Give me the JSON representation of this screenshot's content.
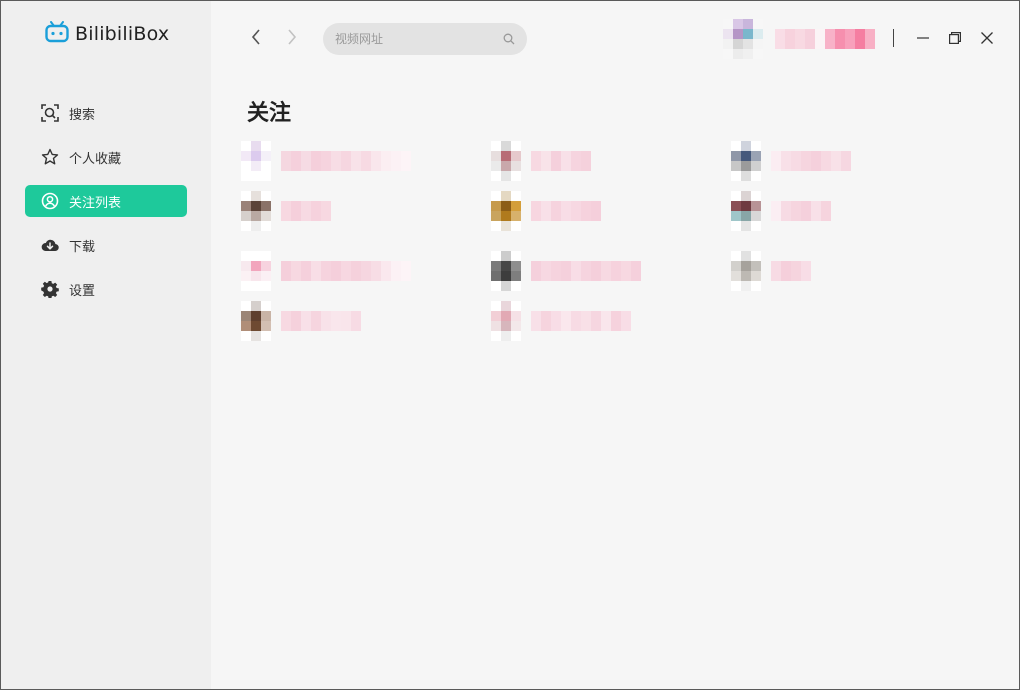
{
  "app": {
    "title": "BilibiliBox"
  },
  "colors": {
    "accent": "#1ec99b",
    "logo": "#1a9fd9"
  },
  "sidebar": {
    "items": [
      {
        "label": "搜索",
        "icon": "search-icon",
        "active": false
      },
      {
        "label": "个人收藏",
        "icon": "star-icon",
        "active": false
      },
      {
        "label": "关注列表",
        "icon": "user-circle-icon",
        "active": true
      },
      {
        "label": "下载",
        "icon": "cloud-download-icon",
        "active": false
      },
      {
        "label": "设置",
        "icon": "gear-icon",
        "active": false
      }
    ]
  },
  "topbar": {
    "back_icon": "chevron-left-icon",
    "forward_icon": "chevron-right-icon",
    "search": {
      "placeholder": "视频网址",
      "value": "",
      "icon": "search-icon"
    },
    "window_controls": [
      "minimize-icon",
      "restore-icon",
      "close-icon"
    ]
  },
  "main": {
    "title": "关注"
  },
  "follows": [
    {
      "avatar": [
        "#fff",
        "#e8dcef",
        "#fff",
        "#f2e9f6",
        "#dccbee",
        "#f4f0f8",
        "#fff",
        "#f3ecf6",
        "#fff",
        "#fff",
        "#fff",
        "#fff"
      ],
      "name": [
        "#f5d7e0",
        "#f5d0dc",
        "#f6dbe4",
        "#f5cfdb",
        "#f6d3de",
        "#f7dde5",
        "#f6d6e0",
        "#f8e2e9",
        "#f7dae3",
        "#f9e6ec",
        "#fbeef2",
        "#fcf1f5",
        "#fdf4f7"
      ]
    },
    {
      "avatar": [
        "#fff",
        "#d9d9d9",
        "#fff",
        "#e7dede",
        "#b86d76",
        "#e6c9cc",
        "#eaeaea",
        "#c9a8ab",
        "#e8e0e0",
        "#fff",
        "#e5e5e5",
        "#fff"
      ],
      "name": [
        "#f7d9e2",
        "#f8e3e9",
        "#f5d0dc",
        "#f8e0e8",
        "#f6d4df",
        "#f5d1dc"
      ]
    },
    {
      "avatar": [
        "#fff",
        "#cfd3dd",
        "#fff",
        "#8f97a8",
        "#46597c",
        "#9aa3b4",
        "#c7c7c7",
        "#9b9b9b",
        "#d0d0d0",
        "#fff",
        "#dedede",
        "#fff"
      ],
      "name": [
        "#fbedf2",
        "#f8e0e8",
        "#f7dbe4",
        "#f6d5df",
        "#f5d0dc",
        "#f7d9e2",
        "#f8e1e8",
        "#f6d7e1"
      ]
    },
    {
      "avatar": [
        "#fff",
        "#e6e0dc",
        "#fff",
        "#9a8278",
        "#5b4338",
        "#8a7268",
        "#d6d0cc",
        "#b9a9a2",
        "#e2dcd8",
        "#fff",
        "#eeeeee",
        "#fff"
      ],
      "name": [
        "#f7d8e1",
        "#f5cfdb",
        "#f7dae3",
        "#f6d2dd",
        "#f7d8e1"
      ]
    },
    {
      "avatar": [
        "#fff",
        "#e4d8c2",
        "#fff",
        "#c69a4b",
        "#8c5d17",
        "#d49e3a",
        "#c9a45e",
        "#b07a1d",
        "#d7b16c",
        "#fff",
        "#e9e3d9",
        "#fff"
      ],
      "name": [
        "#f7d6e0",
        "#f8e0e8",
        "#f6d3de",
        "#f8dde6",
        "#f7d8e2",
        "#f6d2dd",
        "#f5cfdb"
      ]
    },
    {
      "avatar": [
        "#fff",
        "#dbd3d3",
        "#fff",
        "#8a4f55",
        "#6f3a40",
        "#b89396",
        "#9fc6c9",
        "#88a6a7",
        "#d8d8d8",
        "#fff",
        "#e4e4e4",
        "#fff"
      ],
      "name": [
        "#fbeef3",
        "#f7dbe4",
        "#f6d5df",
        "#f5d0dc",
        "#f8e0e8",
        "#f6d4de"
      ]
    },
    {
      "avatar": [
        "#fff",
        "#ffffff",
        "#fff",
        "#f7e9ee",
        "#f2a6bd",
        "#f7d3df",
        "#fbf1f4",
        "#f8e6ec",
        "#fbf0f4",
        "#fff",
        "#fff",
        "#fff"
      ],
      "name": [
        "#f5cfdb",
        "#f7d8e1",
        "#f5d0dc",
        "#f8dee6",
        "#f6d3de",
        "#f5cfdb",
        "#f7d7e1",
        "#f5d1dc",
        "#f6d6e0",
        "#f7dde5",
        "#fae8ee",
        "#fcf1f5",
        "#fdf4f7"
      ]
    },
    {
      "avatar": [
        "#fff",
        "#cccccc",
        "#fff",
        "#7a7a7a",
        "#474747",
        "#8e8e8e",
        "#6f6f6f",
        "#3d3d3d",
        "#7e7e7e",
        "#fff",
        "#d6d6d6",
        "#fff"
      ],
      "name": [
        "#f5d0dc",
        "#f7d8e2",
        "#f6d3de",
        "#f5d0dc",
        "#f8dde6",
        "#f6d4df",
        "#f5cfdb",
        "#f7d9e2",
        "#f6d2dd",
        "#f7d8e1",
        "#f5d0dc"
      ]
    },
    {
      "avatar": [
        "#fff",
        "#e1e1e1",
        "#fff",
        "#d2d0cc",
        "#a6a29c",
        "#c3c0bb",
        "#e2dfdb",
        "#bdb9b3",
        "#dedad5",
        "#fff",
        "#f0f0f0",
        "#fff"
      ],
      "name": [
        "#f7dbe4",
        "#f5cfdb",
        "#f6d4de",
        "#f8dde6"
      ]
    },
    {
      "avatar": [
        "#fff",
        "#d5cfcc",
        "#fff",
        "#9b8576",
        "#5e3f2e",
        "#c9b4a6",
        "#b08e78",
        "#6e4a32",
        "#d3bfb2",
        "#fff",
        "#e6e3e1",
        "#fff"
      ],
      "name": [
        "#f7d9e2",
        "#f5d1dc",
        "#f8e0e8",
        "#f6d5df",
        "#f8e2e9",
        "#f9e6ec",
        "#f9e5eb",
        "#f7dbe4"
      ]
    },
    {
      "avatar": [
        "#fff",
        "#e9d6db",
        "#fff",
        "#f2cfd6",
        "#e2a9b4",
        "#f5e1e6",
        "#efe1e3",
        "#d7b6bc",
        "#f3e8ea",
        "#fff",
        "#eeeeee",
        "#fff"
      ],
      "name": [
        "#f8e0e8",
        "#f6d4de",
        "#f8dde6",
        "#fae7ed",
        "#f7dbe4",
        "#f8e0e7",
        "#f6d6e0",
        "#f9e6ec",
        "#f6d2dd",
        "#f8dde6"
      ]
    }
  ]
}
